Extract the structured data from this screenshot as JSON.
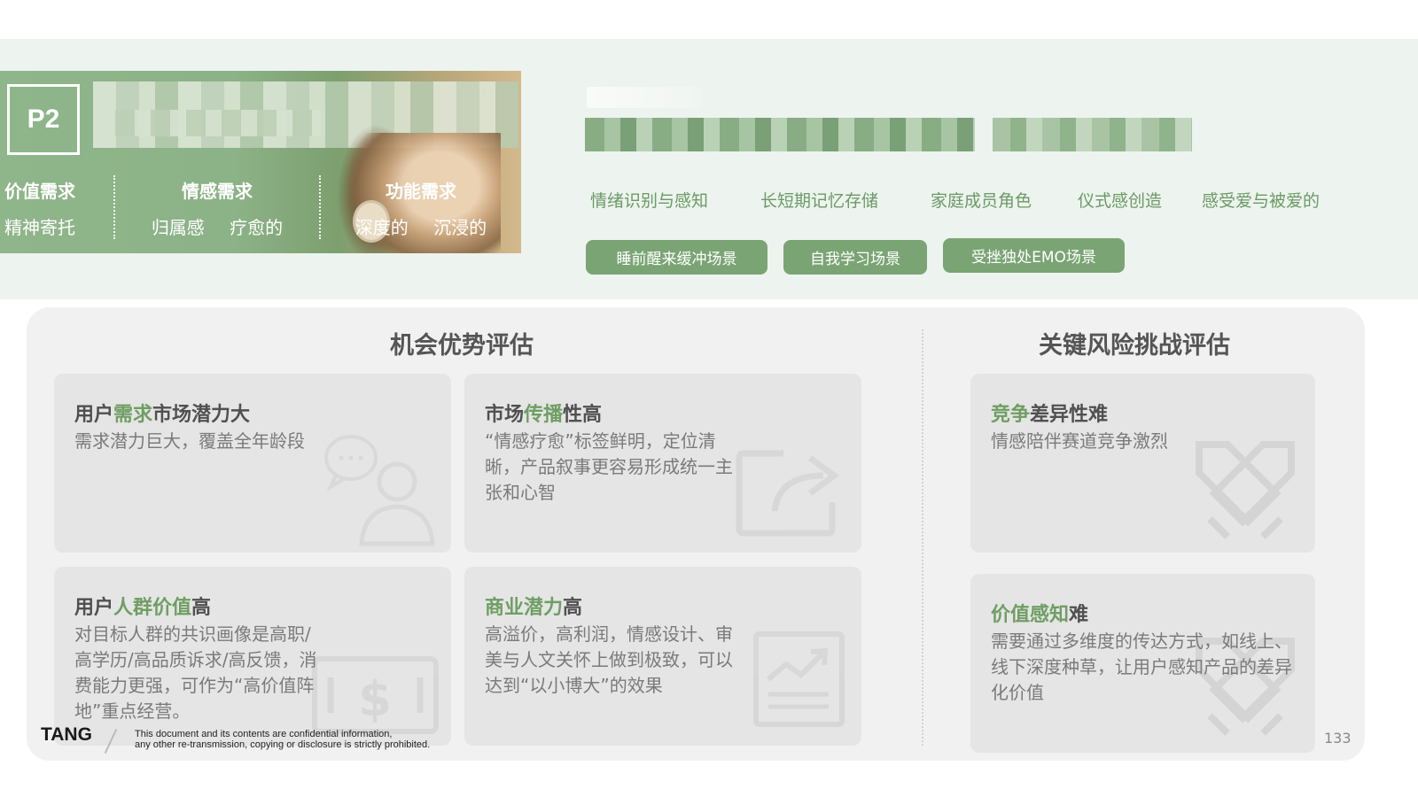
{
  "header": {
    "page_tag": "P2",
    "needs": [
      {
        "title": "价值需求",
        "sub": "精神寄托"
      },
      {
        "title": "情感需求",
        "sub": "归属感 疗愈的"
      },
      {
        "title": "功能需求",
        "sub": "深度的 沉浸的"
      }
    ],
    "tags": [
      "情绪识别与感知",
      "长短期记忆存储",
      "家庭成员角色",
      "仪式感创造",
      "感受爱与被爱的"
    ],
    "scene_buttons": [
      "睡前醒来缓冲场景",
      "自我学习场景",
      "受挫独处EMO场景"
    ]
  },
  "opportunity": {
    "title": "机会优势评估",
    "cards": [
      {
        "pre": "用户",
        "hl": "需求",
        "post": "市场潜力大",
        "desc": "需求潜力巨大，覆盖全年龄段",
        "icon": "user-chat-icon"
      },
      {
        "pre": "市场",
        "hl": "传播",
        "post": "性高",
        "desc": "“情感疗愈”标签鲜明，定位清晰，产品叙事更容易形成统一主张和心智",
        "icon": "share-icon"
      },
      {
        "pre": "用户",
        "hl": "人群价值",
        "post": "高",
        "desc": "对目标人群的共识画像是高职/高学历/高品质诉求/高反馈，消费能力更强，可作为“高价值阵地”重点经营。",
        "icon": "money-icon"
      },
      {
        "pre": "",
        "hl": "商业潜力",
        "post": "高",
        "desc": "高溢价，高利润，情感设计、审美与人文关怀上做到极致，可以达到“以小博大”的效果",
        "icon": "chart-trend-icon"
      }
    ]
  },
  "risk": {
    "title": "关键风险挑战评估",
    "cards": [
      {
        "pre": "",
        "hl": "竞争",
        "post": "差异性难",
        "desc": "情感陪伴赛道竞争激烈",
        "icon": "crossed-swords-icon"
      },
      {
        "pre": "",
        "hl": "价值感知",
        "post": "难",
        "desc": "需要通过多维度的传达方式，如线上、线下深度种草，让用户感知产品的差异化价值",
        "icon": "crossed-swords-icon"
      }
    ]
  },
  "footer": {
    "logo": "TANG",
    "note_line1": "This document and its contents are confidential information,",
    "note_line2": "any other re-transmission, copying or disclosure is strictly prohibited.",
    "page_number": "133"
  },
  "colors": {
    "accent_green": "#6f9e63",
    "button_green": "#7aa474",
    "band_bg": "#edf3ee",
    "panel_bg": "#f1f1f1",
    "card_bg": "#e5e5e5"
  }
}
